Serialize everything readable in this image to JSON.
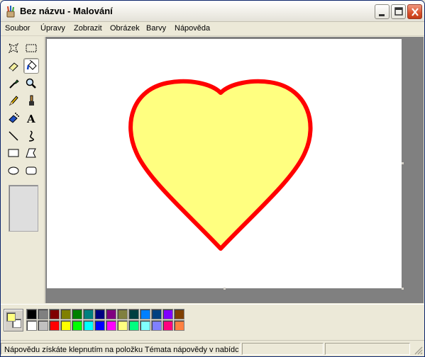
{
  "window": {
    "title": "Bez názvu - Malování",
    "icon": "paint-brush-cup-icon"
  },
  "menu": {
    "items": [
      "Soubor",
      "Úpravy",
      "Zobrazit",
      "Obrázek",
      "Barvy",
      "Nápověda"
    ]
  },
  "toolbox": {
    "tools": [
      {
        "name": "free-form-select",
        "icon": "star-select-icon"
      },
      {
        "name": "rect-select",
        "icon": "dashed-rect-icon"
      },
      {
        "name": "eraser",
        "icon": "eraser-icon"
      },
      {
        "name": "fill",
        "icon": "paint-bucket-icon",
        "active": true
      },
      {
        "name": "pick-color",
        "icon": "eyedropper-icon"
      },
      {
        "name": "magnifier",
        "icon": "magnifier-icon"
      },
      {
        "name": "pencil",
        "icon": "pencil-icon"
      },
      {
        "name": "brush",
        "icon": "brush-icon"
      },
      {
        "name": "airbrush",
        "icon": "airbrush-icon"
      },
      {
        "name": "text",
        "icon": "text-a-icon"
      },
      {
        "name": "line",
        "icon": "line-icon"
      },
      {
        "name": "curve",
        "icon": "curve-icon"
      },
      {
        "name": "rectangle",
        "icon": "rectangle-icon"
      },
      {
        "name": "polygon",
        "icon": "polygon-icon"
      },
      {
        "name": "ellipse",
        "icon": "ellipse-icon"
      },
      {
        "name": "rounded-rectangle",
        "icon": "rounded-rect-icon"
      }
    ]
  },
  "drawing": {
    "shape": "heart",
    "fill_color": "#ffff80",
    "stroke_color": "#ff0000"
  },
  "palette": {
    "foreground": "#ffff80",
    "background": "#ffffff",
    "row1": [
      "#000000",
      "#808080",
      "#800000",
      "#808000",
      "#008000",
      "#008080",
      "#000080",
      "#800080",
      "#808040",
      "#004040",
      "#0080ff",
      "#004080",
      "#8000ff",
      "#804000"
    ],
    "row2": [
      "#ffffff",
      "#c0c0c0",
      "#ff0000",
      "#ffff00",
      "#00ff00",
      "#00ffff",
      "#0000ff",
      "#ff00ff",
      "#ffff80",
      "#00ff80",
      "#80ffff",
      "#8080ff",
      "#ff0080",
      "#ff8040"
    ]
  },
  "status": {
    "text": "Nápovědu získáte klepnutím na položku Témata nápovědy v nabídce Nápověda."
  }
}
